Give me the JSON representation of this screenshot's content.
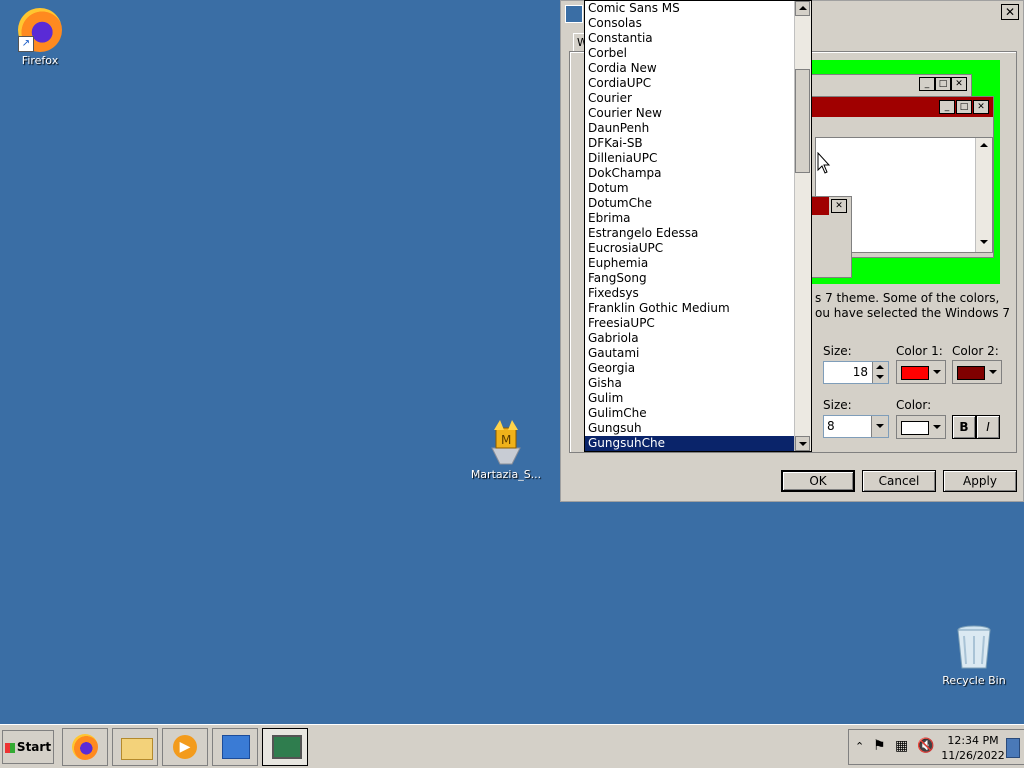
{
  "desktop": {
    "icons": [
      {
        "label": "Firefox"
      },
      {
        "label": "Martazia_S..."
      },
      {
        "label": "Recycle Bin"
      }
    ]
  },
  "dialog": {
    "tab_partial": "W",
    "description_line1": "s 7 theme.  Some of the colors,",
    "description_line2": "ou have selected the Windows 7",
    "size_label_1": "Size:",
    "size_value_1": "18",
    "color1_label": "Color 1:",
    "color2_label": "Color 2:",
    "color1_value": "#ff0000",
    "color2_value": "#800000",
    "size_label_2": "Size:",
    "size_value_2": "8",
    "color_label": "Color:",
    "color_value": "#ffffff",
    "bold_label": "B",
    "italic_label": "I",
    "ok": "OK",
    "cancel": "Cancel",
    "apply": "Apply",
    "close_glyph": "✕"
  },
  "font_list": {
    "items": [
      "Comic Sans MS",
      "Consolas",
      "Constantia",
      "Corbel",
      "Cordia New",
      "CordiaUPC",
      "Courier",
      "Courier New",
      "DaunPenh",
      "DFKai-SB",
      "DilleniaUPC",
      "DokChampa",
      "Dotum",
      "DotumChe",
      "Ebrima",
      "Estrangelo Edessa",
      "EucrosiaUPC",
      "Euphemia",
      "FangSong",
      "Fixedsys",
      "Franklin Gothic Medium",
      "FreesiaUPC",
      "Gabriola",
      "Gautami",
      "Georgia",
      "Gisha",
      "Gulim",
      "GulimChe",
      "Gungsuh",
      "GungsuhChe"
    ],
    "selected": "GungsuhChe"
  },
  "taskbar": {
    "start_label": "Start",
    "time": "12:34 PM",
    "date": "11/26/2022"
  },
  "colors": {
    "desktop_bg": "#3a6ea5",
    "preview_bg": "#00ff00",
    "active_title": "#a00000",
    "selection": "#0a246a"
  }
}
